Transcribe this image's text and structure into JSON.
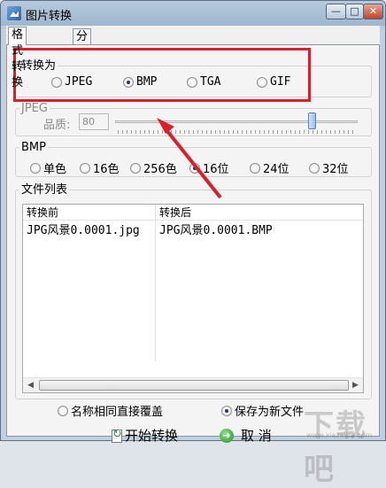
{
  "window": {
    "title": "图片转换",
    "minimize_label": "—",
    "maximize_label": "□",
    "close_label": "✕"
  },
  "tabs": [
    {
      "label": "格式转换",
      "active": true
    },
    {
      "label": "分辨率转换",
      "active": false
    }
  ],
  "convert_to": {
    "label": "转换为",
    "options": [
      {
        "label": "JPEG",
        "checked": false
      },
      {
        "label": "BMP",
        "checked": true
      },
      {
        "label": "TGA",
        "checked": false
      },
      {
        "label": "GIF",
        "checked": false
      }
    ]
  },
  "jpeg": {
    "label": "JPEG",
    "quality_label": "品质:",
    "quality_value": "80",
    "slider_fraction": 0.81
  },
  "bmp": {
    "label": "BMP",
    "options": [
      {
        "label": "单色",
        "checked": false
      },
      {
        "label": "16色",
        "checked": false
      },
      {
        "label": "256色",
        "checked": false
      },
      {
        "label": "16位",
        "checked": true
      },
      {
        "label": "24位",
        "checked": false
      },
      {
        "label": "32位",
        "checked": false
      }
    ]
  },
  "file_list": {
    "label": "文件列表",
    "columns": [
      "转换前",
      "转换后"
    ],
    "rows": [
      [
        "JPG风景0.0001.jpg",
        "JPG风景0.0001.BMP"
      ]
    ],
    "scroll_left": "◀",
    "scroll_right": "▶"
  },
  "save_mode": {
    "options": [
      {
        "label": "名称相同直接覆盖",
        "checked": false
      },
      {
        "label": "保存为新文件",
        "checked": true
      }
    ]
  },
  "actions": {
    "start_label": "开始转换",
    "cancel_label": "取 消"
  },
  "annotation": {
    "color": "#d9202a"
  },
  "watermark": {
    "text": "下载吧",
    "url": "www.xiazaiba.com"
  }
}
